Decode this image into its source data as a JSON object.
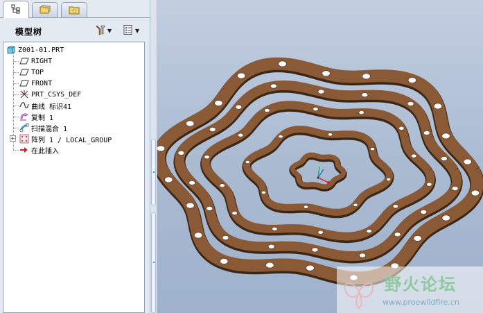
{
  "navigator": {
    "tabs": [
      {
        "icon": "model-tree-icon",
        "active": true
      },
      {
        "icon": "folder-browser-icon",
        "active": false
      },
      {
        "icon": "favorites-icon",
        "active": false
      }
    ],
    "title": "模型树",
    "settings_icon": "tools-icon",
    "show_icon": "list-icon",
    "tree": [
      {
        "label": "Z001-01.PRT",
        "icon": "part-icon"
      },
      {
        "label": "RIGHT",
        "icon": "datum-plane-icon"
      },
      {
        "label": "TOP",
        "icon": "datum-plane-icon"
      },
      {
        "label": "FRONT",
        "icon": "datum-plane-icon"
      },
      {
        "label": "PRT_CSYS_DEF",
        "icon": "csys-icon"
      },
      {
        "label": "曲线 标识41",
        "icon": "curve-icon"
      },
      {
        "label": "复制 1",
        "icon": "copy-icon"
      },
      {
        "label": "扫描混合 1",
        "icon": "sweep-blend-icon"
      },
      {
        "label": "阵列 1 / LOCAL_GROUP",
        "icon": "pattern-icon"
      },
      {
        "label": "在此插入",
        "icon": "insert-here-arrow-icon"
      }
    ]
  },
  "graphics": {
    "model_color": "#8a5a36",
    "background_top": "#c2cee0",
    "background_bottom": "#9fb2cc"
  },
  "watermark": {
    "text": "野火论坛",
    "url": "www.proewildfire.cn"
  }
}
